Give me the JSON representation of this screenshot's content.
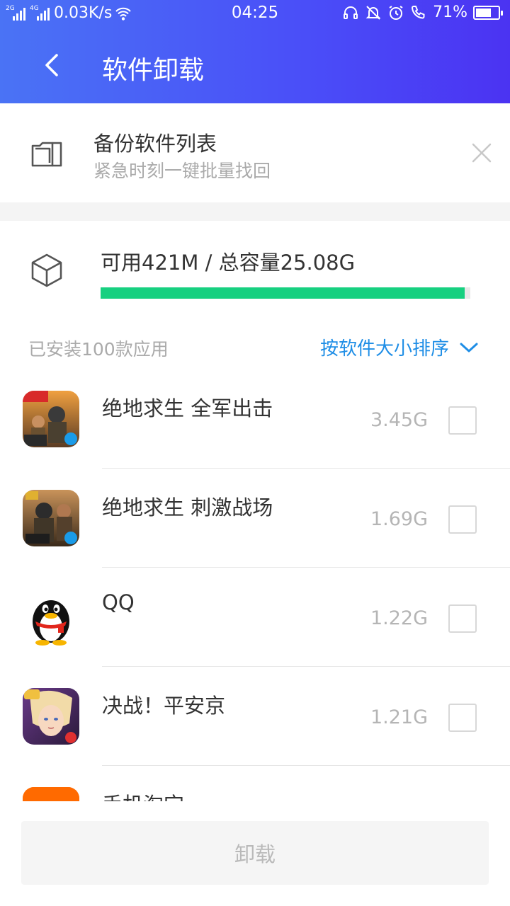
{
  "status_bar": {
    "net1": "2G",
    "net2": "4G",
    "speed": "0.03K/s",
    "time": "04:25",
    "battery_text": "71%",
    "battery_level": 0.71
  },
  "header": {
    "title": "软件卸载"
  },
  "backup": {
    "title": "备份软件列表",
    "subtitle": "紧急时刻一键批量找回"
  },
  "storage": {
    "text": "可用421M / 总容量25.08G",
    "used_fraction": 0.984,
    "bar_color": "#17d080"
  },
  "list_header": {
    "installed": "已安装100款应用",
    "sort": "按软件大小排序"
  },
  "apps": [
    {
      "name": "绝地求生 全军出击",
      "size": "3.45G",
      "icon": "pubg-full-army-icon",
      "checked": false
    },
    {
      "name": "绝地求生 刺激战场",
      "size": "1.69G",
      "icon": "pubg-exciting-battlefield-icon",
      "checked": false
    },
    {
      "name": "QQ",
      "size": "1.22G",
      "icon": "qq-penguin-icon",
      "checked": false
    },
    {
      "name": "决战！平安京",
      "size": "1.21G",
      "icon": "onmyoji-arena-icon",
      "checked": false
    },
    {
      "name": "手机淘宝",
      "size": "",
      "icon": "taobao-icon",
      "checked": false
    }
  ],
  "footer": {
    "uninstall_label": "卸载"
  },
  "colors": {
    "accent": "#1f8ee6",
    "header_start": "#4a73f5",
    "header_end": "#4b33f2"
  }
}
